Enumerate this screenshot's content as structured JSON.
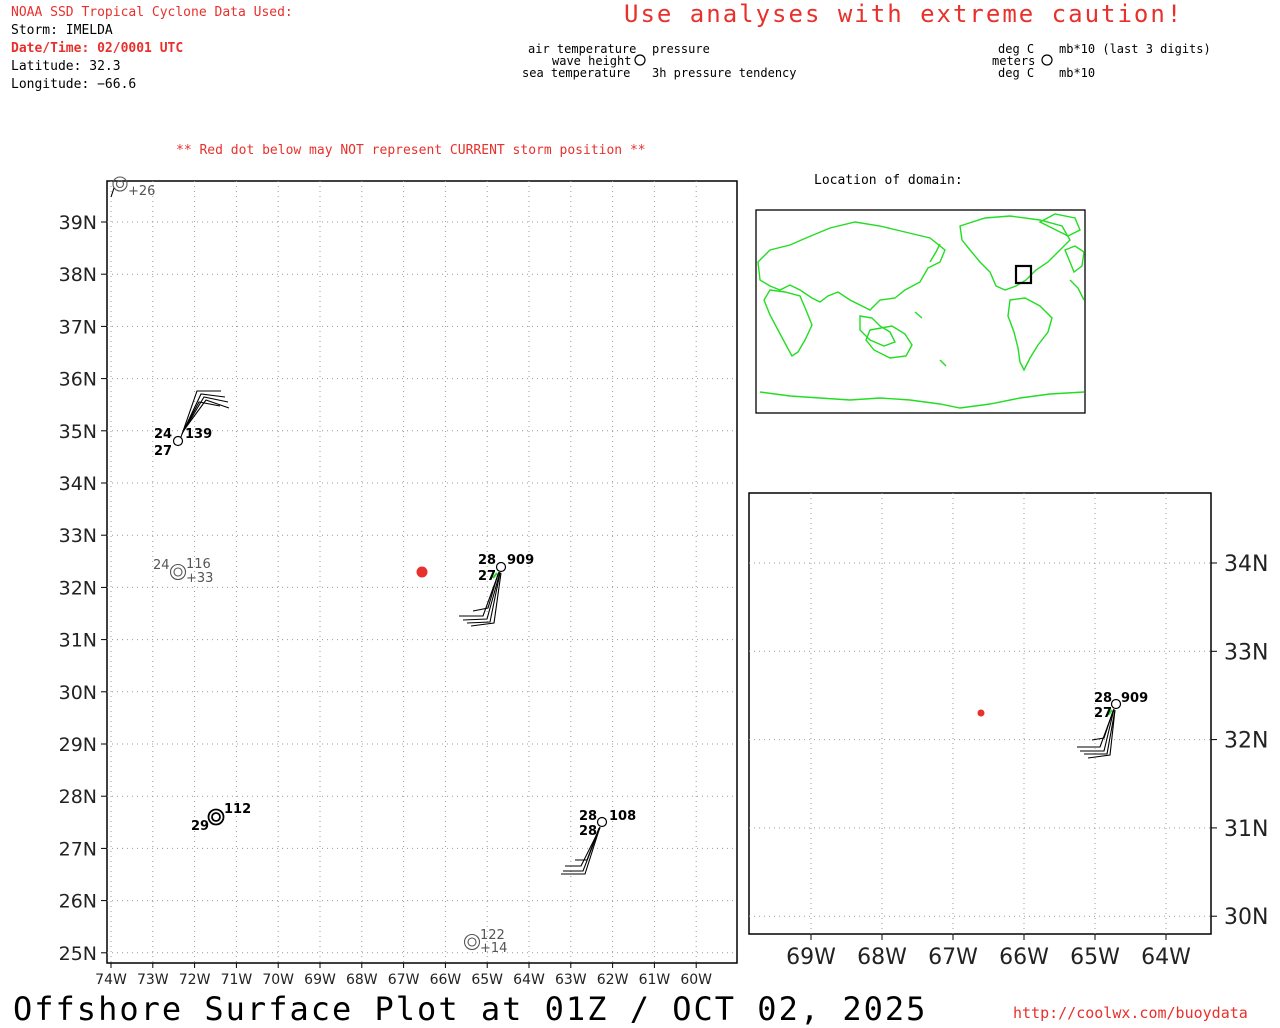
{
  "header": {
    "title": "NOAA SSD Tropical Cyclone Data Used:",
    "storm": "Storm: IMELDA",
    "datetime": "Date/Time: 02/0001 UTC",
    "latitude": "Latitude: 32.3",
    "longitude": "Longitude: −66.6",
    "caution": "Use analyses with extreme caution!",
    "red_dot_note": "** Red dot below may NOT represent CURRENT storm position **",
    "location_label": "Location of domain:"
  },
  "legend": {
    "air_temp": "air temperature",
    "wave_height": "wave height",
    "sea_temp": "sea temperature",
    "pressure": "pressure",
    "tendency": "3h pressure tendency",
    "deg_c_top": "deg C",
    "meters": "meters",
    "deg_c_bottom": "deg C",
    "mb_last3": "mb*10 (last 3 digits)",
    "mb10": "mb*10"
  },
  "main_map": {
    "lat_labels": [
      "39N",
      "38N",
      "37N",
      "36N",
      "35N",
      "34N",
      "33N",
      "32N",
      "31N",
      "30N",
      "29N",
      "28N",
      "27N",
      "26N",
      "25N"
    ],
    "lon_labels": [
      "74W",
      "73W",
      "72W",
      "71W",
      "70W",
      "69W",
      "68W",
      "67W",
      "66W",
      "65W",
      "64W",
      "63W",
      "62W",
      "61W",
      "60W"
    ],
    "stations": [
      {
        "air": "24",
        "sea": "27",
        "pressure": "139",
        "tendency": ""
      },
      {
        "air": "24",
        "sea": "",
        "pressure": "116",
        "tendency": "+33"
      },
      {
        "air": "28",
        "sea": "27",
        "pressure": "909",
        "tendency": ""
      },
      {
        "air": "29",
        "sea": "",
        "pressure": "112",
        "tendency": ""
      },
      {
        "air": "28",
        "sea": "28",
        "pressure": "108",
        "tendency": ""
      },
      {
        "air": "",
        "sea": "",
        "pressure": "122",
        "tendency": "+14"
      },
      {
        "air": "",
        "sea": "",
        "pressure": "",
        "tendency": "+26"
      }
    ]
  },
  "zoom_map": {
    "lat_labels": [
      "34N",
      "33N",
      "32N",
      "31N",
      "30N"
    ],
    "lon_labels": [
      "69W",
      "68W",
      "67W",
      "66W",
      "65W",
      "64W"
    ],
    "station": {
      "air": "28",
      "sea": "27",
      "pressure": "909"
    }
  },
  "footer": {
    "title": "Offshore Surface Plot at 01Z / OCT 02, 2025",
    "url": "http://coolwx.com/buoydata"
  },
  "colors": {
    "red": "#e8302c",
    "land": "#22dd22",
    "grid": "#999999"
  }
}
